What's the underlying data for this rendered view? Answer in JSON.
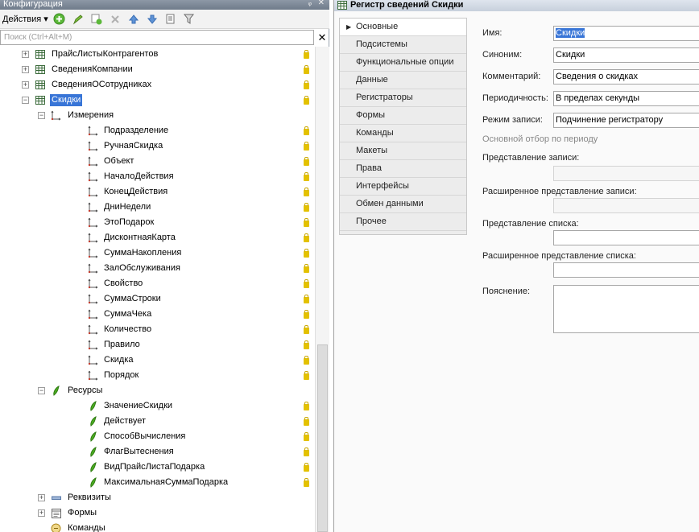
{
  "left_panel": {
    "title": "Конфигурация",
    "actions_label": "Действия",
    "search_placeholder": "Поиск (Ctrl+Alt+M)",
    "tree": [
      {
        "label": "ПрайсЛистыКонтрагентов",
        "level": 1,
        "icon": "table-icon",
        "expander": "+",
        "lock": true
      },
      {
        "label": "СведенияКомпании",
        "level": 1,
        "icon": "table-icon",
        "expander": "+",
        "lock": true
      },
      {
        "label": "СведенияОСотрудниках",
        "level": 1,
        "icon": "table-icon",
        "expander": "+",
        "lock": true
      },
      {
        "label": "Скидки",
        "level": 1,
        "icon": "table-icon",
        "expander": "−",
        "lock": true,
        "selected": true
      },
      {
        "label": "Измерения",
        "level": 2,
        "icon": "dimension-group-icon",
        "expander": "−",
        "lock": false
      },
      {
        "label": "Подразделение",
        "level": 3,
        "icon": "dimension-icon",
        "lock": true
      },
      {
        "label": "РучнаяСкидка",
        "level": 3,
        "icon": "dimension-icon",
        "lock": true
      },
      {
        "label": "Объект",
        "level": 3,
        "icon": "dimension-icon",
        "lock": true
      },
      {
        "label": "НачалоДействия",
        "level": 3,
        "icon": "dimension-icon",
        "lock": true
      },
      {
        "label": "КонецДействия",
        "level": 3,
        "icon": "dimension-icon",
        "lock": true
      },
      {
        "label": "ДниНедели",
        "level": 3,
        "icon": "dimension-icon",
        "lock": true
      },
      {
        "label": "ЭтоПодарок",
        "level": 3,
        "icon": "dimension-icon",
        "lock": true
      },
      {
        "label": "ДисконтнаяКарта",
        "level": 3,
        "icon": "dimension-icon",
        "lock": true
      },
      {
        "label": "СуммаНакопления",
        "level": 3,
        "icon": "dimension-icon",
        "lock": true
      },
      {
        "label": "ЗалОбслуживания",
        "level": 3,
        "icon": "dimension-icon",
        "lock": true
      },
      {
        "label": "Свойство",
        "level": 3,
        "icon": "dimension-icon",
        "lock": true
      },
      {
        "label": "СуммаСтроки",
        "level": 3,
        "icon": "dimension-icon",
        "lock": true
      },
      {
        "label": "СуммаЧека",
        "level": 3,
        "icon": "dimension-icon",
        "lock": true
      },
      {
        "label": "Количество",
        "level": 3,
        "icon": "dimension-icon",
        "lock": true
      },
      {
        "label": "Правило",
        "level": 3,
        "icon": "dimension-icon",
        "lock": true
      },
      {
        "label": "Скидка",
        "level": 3,
        "icon": "dimension-icon",
        "lock": true
      },
      {
        "label": "Порядок",
        "level": 3,
        "icon": "dimension-icon",
        "lock": true
      },
      {
        "label": "Ресурсы",
        "level": 2,
        "icon": "resource-group-icon",
        "expander": "−",
        "lock": false
      },
      {
        "label": "ЗначениеСкидки",
        "level": 3,
        "icon": "resource-icon",
        "lock": true
      },
      {
        "label": "Действует",
        "level": 3,
        "icon": "resource-icon",
        "lock": true
      },
      {
        "label": "СпособВычисления",
        "level": 3,
        "icon": "resource-icon",
        "lock": true
      },
      {
        "label": "ФлагВытеснения",
        "level": 3,
        "icon": "resource-icon",
        "lock": true
      },
      {
        "label": "ВидПрайсЛистаПодарка",
        "level": 3,
        "icon": "resource-icon",
        "lock": true
      },
      {
        "label": "МаксимальнаяСуммаПодарка",
        "level": 3,
        "icon": "resource-icon",
        "lock": true
      },
      {
        "label": "Реквизиты",
        "level": 2,
        "icon": "attribute-icon",
        "expander": "+",
        "lock": false
      },
      {
        "label": "Формы",
        "level": 2,
        "icon": "form-icon",
        "expander": "+",
        "lock": false
      },
      {
        "label": "Команды",
        "level": 2,
        "icon": "command-icon",
        "lock": false
      }
    ]
  },
  "right_panel": {
    "title": "Регистр сведений Скидки",
    "nav": [
      "Основные",
      "Подсистемы",
      "Функциональные опции",
      "Данные",
      "Регистраторы",
      "Формы",
      "Команды",
      "Макеты",
      "Права",
      "Интерфейсы",
      "Обмен данными",
      "Прочее"
    ],
    "fields": {
      "name_label": "Имя:",
      "name_value": "Скидки",
      "synonym_label": "Синоним:",
      "synonym_value": "Скидки",
      "comment_label": "Комментарий:",
      "comment_value": "Сведения о скидках",
      "periodicity_label": "Периодичность:",
      "periodicity_value": "В пределах секунды",
      "write_mode_label": "Режим записи:",
      "write_mode_value": "Подчинение регистратору",
      "period_filter_label": "Основной отбор по периоду",
      "record_repr_label": "Представление записи:",
      "ext_record_repr_label": "Расширенное представление записи:",
      "list_repr_label": "Представление списка:",
      "ext_list_repr_label": "Расширенное представление списка:",
      "explanation_label": "Пояснение:"
    }
  },
  "colors": {
    "selection": "#3875d7",
    "lock": "#e3c100",
    "resource": "#4caf22"
  }
}
